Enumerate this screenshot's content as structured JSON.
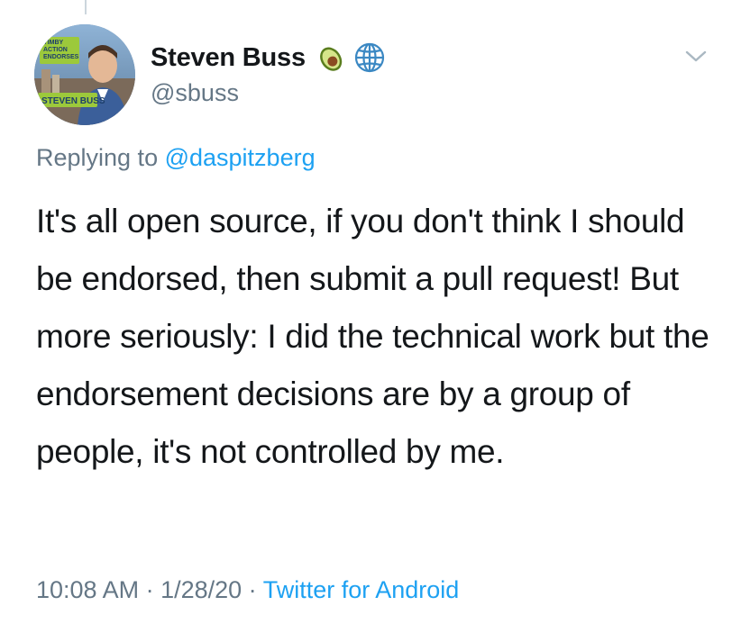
{
  "tweet": {
    "author": {
      "display_name": "Steven Buss",
      "handle": "@sbuss",
      "emoji_icon": "avocado-icon",
      "globe_icon": "globe-icon",
      "avatar": {
        "badge_top": "YIMBY\nACTION\nENDORSES",
        "badge_top_line1": "YIMBY",
        "badge_top_line2": "ACTION",
        "badge_top_line3": "ENDORSES",
        "badge_bottom": "STEVEN BUSS"
      }
    },
    "replying_prefix": "Replying to ",
    "replying_to": "@daspitzberg",
    "text": "It's all open source, if you don't think I should be endorsed, then submit a pull request! But more seriously: I did the technical work but the endorsement decisions are by a group of people, it's not controlled by me.",
    "time": "10:08 AM",
    "separator": " · ",
    "date": "1/28/20",
    "source": "Twitter for Android",
    "menu_icon": "chevron-down-icon"
  },
  "colors": {
    "link": "#1da1f2",
    "secondary": "#657786",
    "text": "#14171a",
    "badge_green": "#9cc93b"
  }
}
